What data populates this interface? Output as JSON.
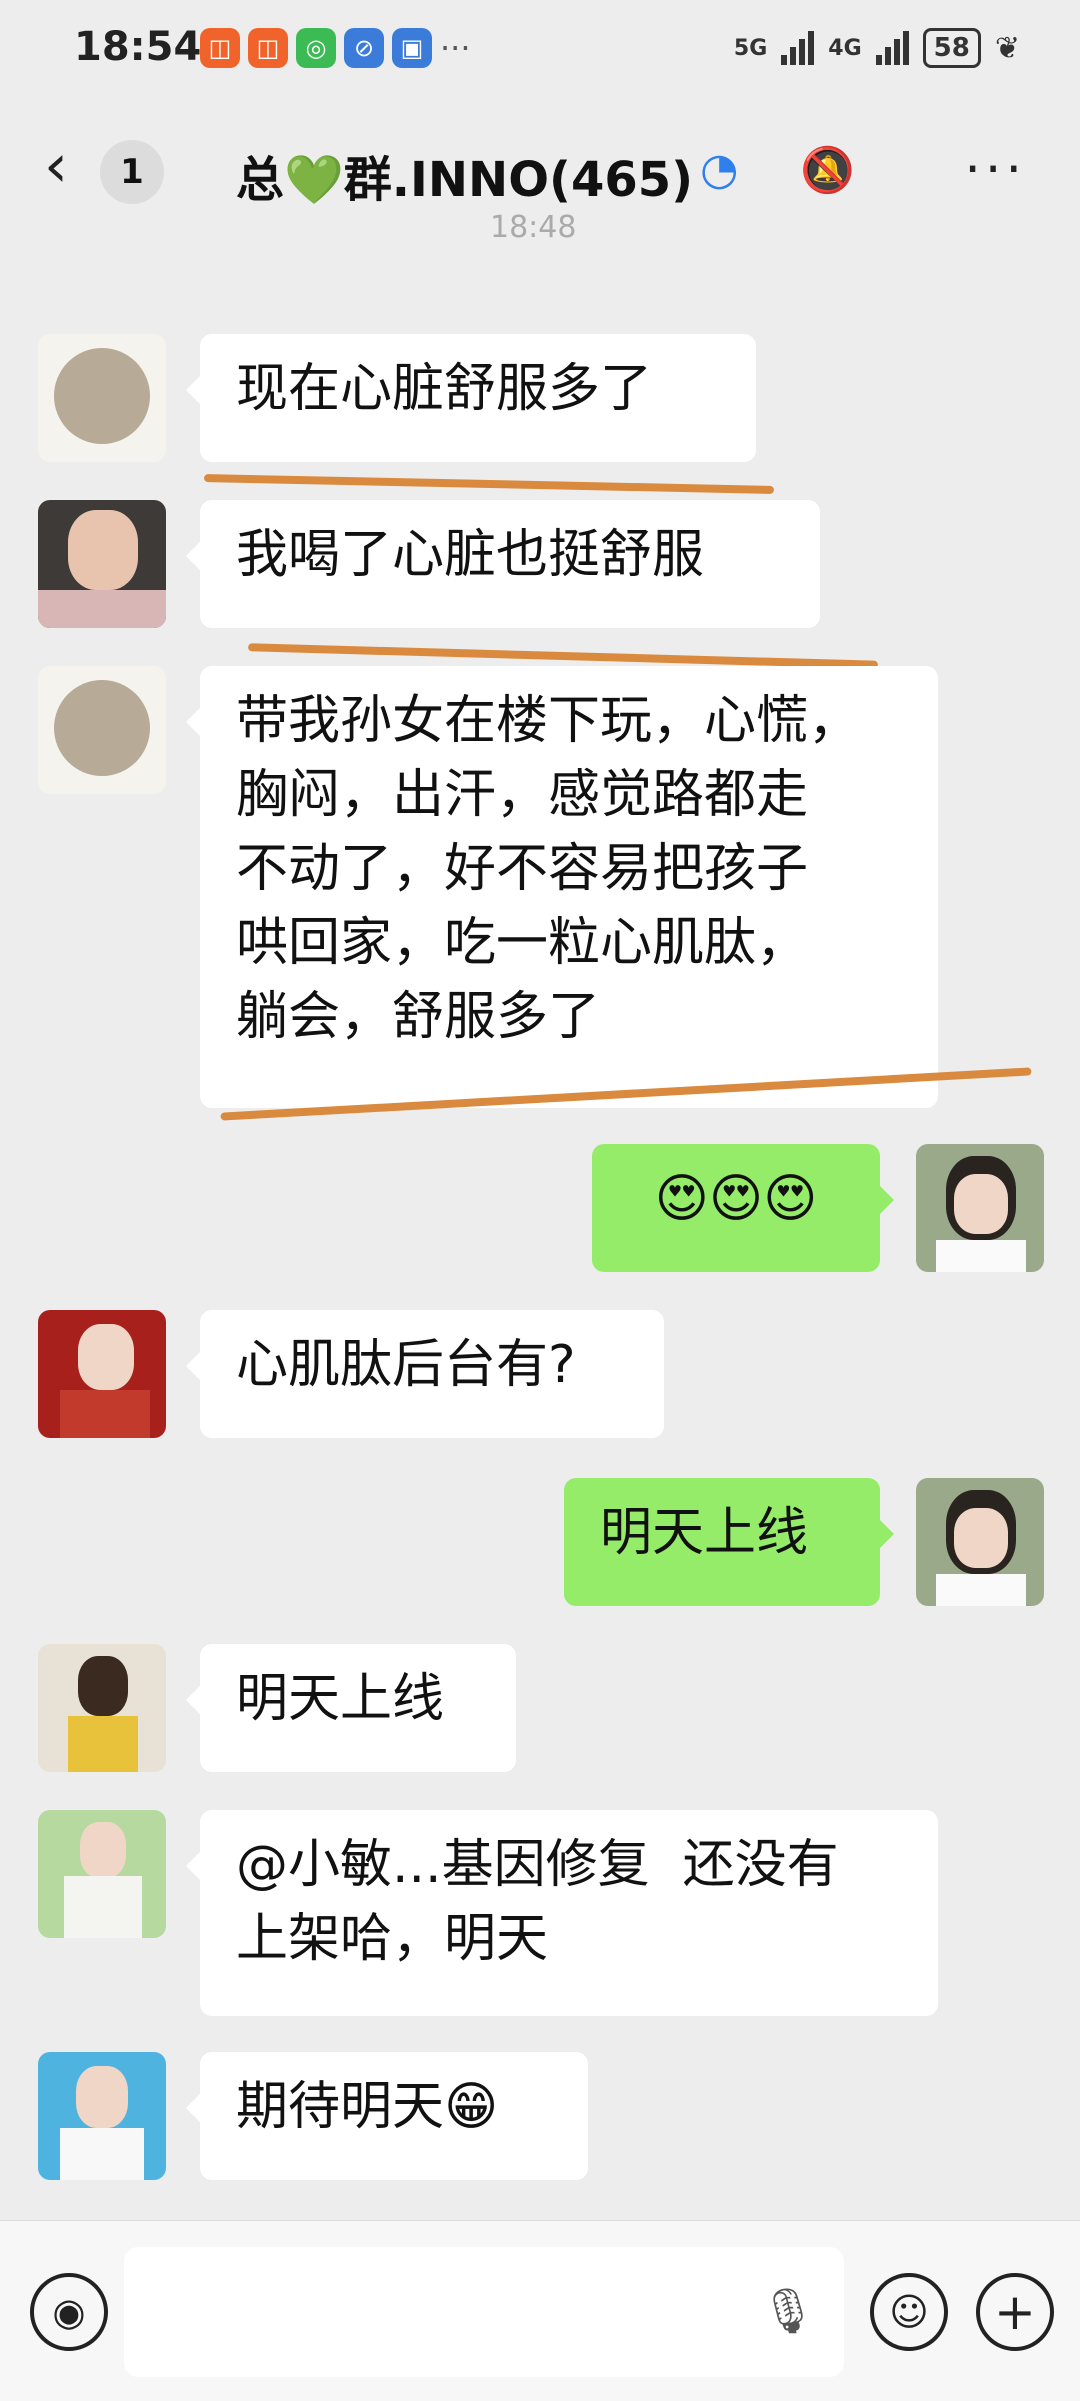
{
  "status_bar": {
    "time": "18:54",
    "signal_5g": "5G",
    "signal_4g": "4G",
    "battery": "58"
  },
  "nav": {
    "back_glyph": "‹",
    "unread_count": "1",
    "title_prefix": "总",
    "title_heart": "💚",
    "title_suffix": "群.INNO(465)"
  },
  "timestamp": "18:48",
  "messages": [
    {
      "side": "left",
      "text": "现在心脏舒服多了"
    },
    {
      "side": "left",
      "text": "我喝了心脏也挺舒服"
    },
    {
      "side": "left",
      "text": "带我孙女在楼下玩，心慌，\n胸闷，出汗，感觉路都走\n不动了，好不容易把孩子\n哄回家，吃一粒心肌肽，\n躺会，舒服多了"
    },
    {
      "side": "right",
      "text": "😍😍😍"
    },
    {
      "side": "left",
      "text": "心肌肽后台有?"
    },
    {
      "side": "right",
      "text": "明天上线"
    },
    {
      "side": "left",
      "text": "明天上线"
    },
    {
      "side": "left",
      "text": "@小敏...基因修复  还没有\n上架哈，明天"
    },
    {
      "side": "left",
      "text": "期待明天😁"
    }
  ],
  "colors": {
    "bubble_right": "#95ec69",
    "underline": "#d98a3f",
    "bg": "#ededed"
  },
  "icons": {
    "voice": "voice-icon",
    "emoji": "emoji-icon",
    "plus": "plus-icon",
    "mic": "mic-icon",
    "more": "more-icon",
    "mute": "mute-icon"
  }
}
